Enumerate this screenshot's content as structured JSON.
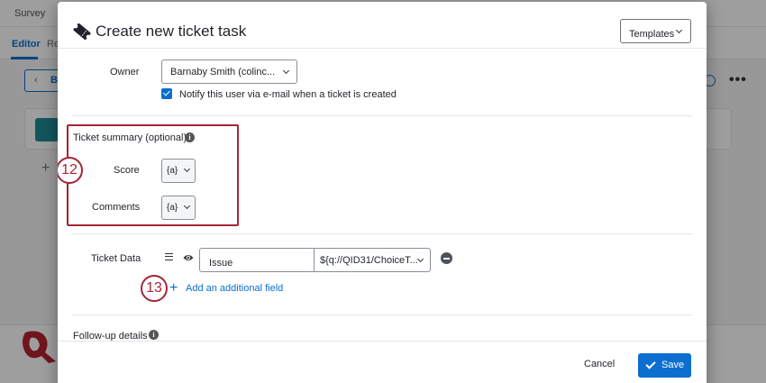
{
  "background": {
    "app_title": "Survey",
    "tab_editor": "Editor",
    "tab_re": "Re",
    "back_label": "B"
  },
  "modal": {
    "title": "Create new ticket task",
    "templates_button": "Templates",
    "owner": {
      "label": "Owner",
      "value": "Barnaby Smith (colinc...",
      "notify_label": "Notify this user via e-mail when a ticket is created",
      "notify_checked": true
    },
    "ticket_summary": {
      "heading": "Ticket summary (optional)",
      "fields": [
        {
          "label": "Score",
          "piped_text": "{a}"
        },
        {
          "label": "Comments",
          "piped_text": "{a}"
        }
      ]
    },
    "ticket_data": {
      "label": "Ticket Data",
      "field_name": "Issue",
      "field_value": "${q://QID31/ChoiceT..."
    },
    "add_field_label": "Add an additional field",
    "follow_up_label": "Follow-up details",
    "callouts": {
      "first": "12",
      "second": "13"
    },
    "footer": {
      "cancel": "Cancel",
      "save": "Save"
    }
  },
  "colors": {
    "accent": "#0b6ed0",
    "callout": "#a52535"
  }
}
